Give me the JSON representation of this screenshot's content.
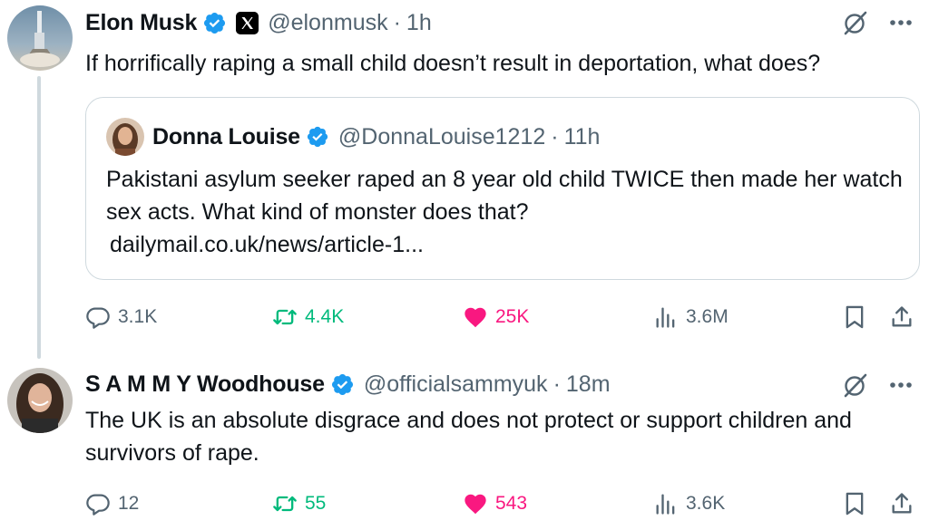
{
  "colors": {
    "verified": "#1d9bf0",
    "secondary_text": "#536471",
    "retweet_active": "#00ba7c",
    "like_active": "#f91880",
    "border": "#cfd9de"
  },
  "tweets": [
    {
      "author": {
        "name": "Elon Musk",
        "handle": "@elonmusk",
        "verified": true,
        "affiliate_badge": "x-logo-icon"
      },
      "time": "1h",
      "text": "If horrifically raping a small child doesn’t result in deportation, what does?",
      "quote": {
        "author": {
          "name": "Donna Louise",
          "handle": "@DonnaLouise1212",
          "verified": true
        },
        "time": "11h",
        "text": "Pakistani asylum seeker raped an 8 year old child TWICE then made her watch sex acts. What kind of monster does that?",
        "link": "dailymail.co.uk/news/article-1..."
      },
      "stats": {
        "replies": "3.1K",
        "retweets": "4.4K",
        "likes": "25K",
        "views": "3.6M"
      },
      "liked": true,
      "retweeted": true
    },
    {
      "author": {
        "name": "S A M M Y Woodhouse",
        "handle": "@officialsammyuk",
        "verified": true
      },
      "time": "18m",
      "text": "The UK is an absolute disgrace and does not protect or support children and survivors of rape.",
      "stats": {
        "replies": "12",
        "retweets": "55",
        "likes": "543",
        "views": "3.6K"
      },
      "liked": true,
      "retweeted": true
    }
  ],
  "separator": "·"
}
